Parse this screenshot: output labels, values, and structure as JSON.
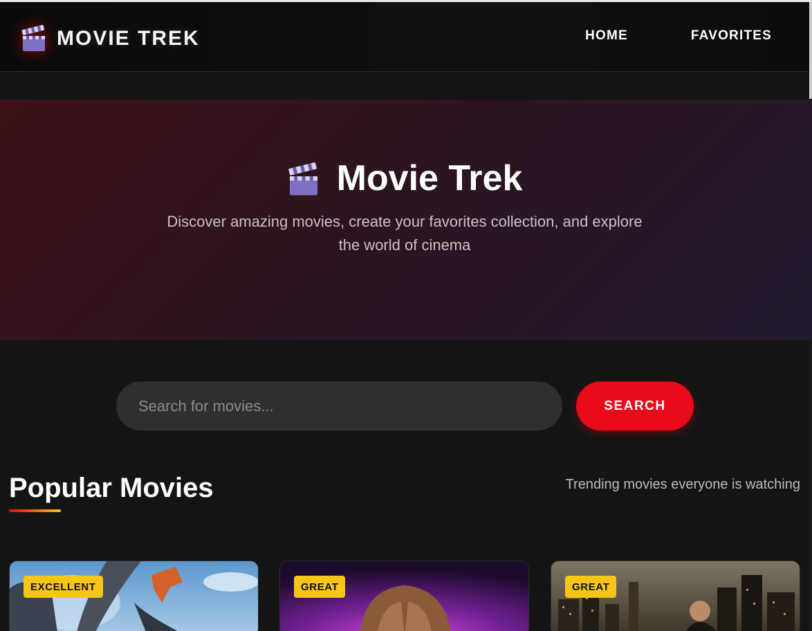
{
  "brand": {
    "name": "MOVIE TREK",
    "icon": "clapperboard-icon"
  },
  "nav": {
    "items": [
      {
        "label": "HOME"
      },
      {
        "label": "FAVORITES"
      }
    ]
  },
  "hero": {
    "icon": "clapperboard-icon",
    "title": "Movie Trek",
    "subtitle": "Discover amazing movies, create your favorites collection, and explore the world of cinema"
  },
  "search": {
    "placeholder": "Search for movies...",
    "value": "",
    "button_label": "SEARCH"
  },
  "section": {
    "title": "Popular Movies",
    "subtitle": "Trending movies everyone is watching"
  },
  "movies": [
    {
      "badge": "EXCELLENT"
    },
    {
      "badge": "GREAT"
    },
    {
      "badge": "GREAT"
    }
  ],
  "colors": {
    "background": "#141414",
    "accent_red": "#eb0a1a",
    "badge_yellow": "#f5c518"
  }
}
